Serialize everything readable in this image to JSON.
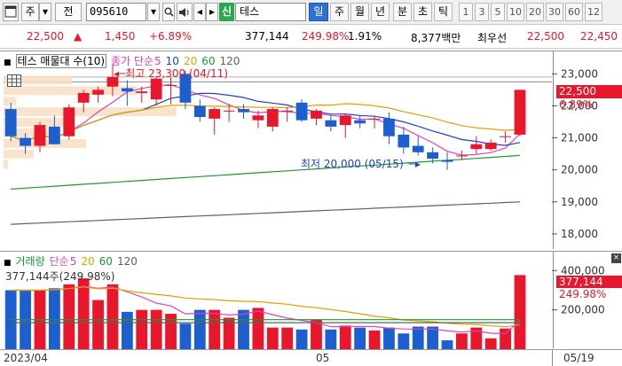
{
  "toolbar": {
    "menu_label": "주",
    "period_label": "전",
    "stock_code": "095610",
    "credit_badge": "신",
    "stock_name": "테스",
    "timeframes": [
      "일",
      "주",
      "월",
      "년",
      "분",
      "초",
      "틱"
    ],
    "active_timeframe": "일",
    "intervals": [
      "1",
      "3",
      "5",
      "10",
      "20",
      "30",
      "60",
      "12"
    ]
  },
  "quote": {
    "price": "22,500",
    "change": "1,450",
    "change_pct": "+6.89%",
    "volume": "377,144",
    "volume_ratio": "249.98%",
    "turnover_rate": "1.91%",
    "amount": "8,377백만",
    "best_ask_label": "최우선",
    "best_bid": "22,500",
    "best_ask": "22,450"
  },
  "price_panel": {
    "legend": {
      "title": "테스 매물대 수(10)",
      "ma_label": "종가 단순",
      "ma_periods": [
        "5",
        "10",
        "20",
        "60",
        "120"
      ]
    },
    "high_annotation": "최고 23,300 (04/11)",
    "low_annotation": "최저 20,000 (05/15)",
    "axis_labels": [
      "23,000",
      "22,000",
      "21,000",
      "20,000",
      "19,000",
      "18,000"
    ],
    "current_price_label": "22,500",
    "current_pct_label": "6.89%"
  },
  "volume_panel": {
    "legend": {
      "title": "거래량",
      "ma_label": "단순",
      "ma_periods": [
        "5",
        "20",
        "60",
        "120"
      ]
    },
    "value_label": "377,144주(249.98%)",
    "axis_labels": [
      "400,000",
      "200,000"
    ],
    "current_volume_label": "377,144",
    "current_pct_label": "249.98%"
  },
  "date_axis": {
    "labels": [
      "2023/04",
      "05"
    ],
    "current_date": "05/19"
  },
  "colors": {
    "up": "#e8172b",
    "down": "#1e5fd0",
    "ma5": "#e040c0",
    "ma10": "#2040d0",
    "ma20": "#e0a000",
    "ma60": "#1a9a30",
    "ma120": "#606060",
    "active_tab": "#2e6fd8"
  },
  "chart_data": [
    {
      "type": "candlestick",
      "title": "테스 매물대 수(10)",
      "series": [
        {
          "date_index": 0,
          "open": 21900,
          "high": 22100,
          "low": 20900,
          "close": 21050
        },
        {
          "date_index": 1,
          "open": 21000,
          "high": 21150,
          "low": 20500,
          "close": 20750
        },
        {
          "date_index": 2,
          "open": 20750,
          "high": 21500,
          "low": 20550,
          "close": 21400
        },
        {
          "date_index": 3,
          "open": 21350,
          "high": 21700,
          "low": 20800,
          "close": 20800
        },
        {
          "date_index": 4,
          "open": 21050,
          "high": 22050,
          "low": 20950,
          "close": 21950
        },
        {
          "date_index": 5,
          "open": 22100,
          "high": 22500,
          "low": 21800,
          "close": 22400
        },
        {
          "date_index": 6,
          "open": 22350,
          "high": 22600,
          "low": 22100,
          "close": 22500
        },
        {
          "date_index": 7,
          "open": 22600,
          "high": 23300,
          "low": 22300,
          "close": 22900
        },
        {
          "date_index": 8,
          "open": 22550,
          "high": 22800,
          "low": 22000,
          "close": 22450
        },
        {
          "date_index": 9,
          "open": 22400,
          "high": 22600,
          "low": 22100,
          "close": 22450
        },
        {
          "date_index": 10,
          "open": 22200,
          "high": 22900,
          "low": 22000,
          "close": 22850
        },
        {
          "date_index": 11,
          "open": 22650,
          "high": 22900,
          "low": 22050,
          "close": 22650
        },
        {
          "date_index": 12,
          "open": 23000,
          "high": 23100,
          "low": 21900,
          "close": 22100
        },
        {
          "date_index": 13,
          "open": 22000,
          "high": 22200,
          "low": 21500,
          "close": 21650
        },
        {
          "date_index": 14,
          "open": 21600,
          "high": 21950,
          "low": 21100,
          "close": 21900
        },
        {
          "date_index": 15,
          "open": 21850,
          "high": 22050,
          "low": 21500,
          "close": 21850
        },
        {
          "date_index": 16,
          "open": 21900,
          "high": 22050,
          "low": 21600,
          "close": 21800
        },
        {
          "date_index": 17,
          "open": 21550,
          "high": 21850,
          "low": 21300,
          "close": 21700
        },
        {
          "date_index": 18,
          "open": 21350,
          "high": 21950,
          "low": 21200,
          "close": 21900
        },
        {
          "date_index": 19,
          "open": 21850,
          "high": 21950,
          "low": 21500,
          "close": 21850
        },
        {
          "date_index": 20,
          "open": 22100,
          "high": 22200,
          "low": 21500,
          "close": 21550
        },
        {
          "date_index": 21,
          "open": 21600,
          "high": 21900,
          "low": 21400,
          "close": 21850
        },
        {
          "date_index": 22,
          "open": 21550,
          "high": 21700,
          "low": 21200,
          "close": 21350
        },
        {
          "date_index": 23,
          "open": 21400,
          "high": 21750,
          "low": 21000,
          "close": 21700
        },
        {
          "date_index": 24,
          "open": 21550,
          "high": 21700,
          "low": 21300,
          "close": 21450
        },
        {
          "date_index": 25,
          "open": 21600,
          "high": 21700,
          "low": 21300,
          "close": 21600
        },
        {
          "date_index": 26,
          "open": 21600,
          "high": 21800,
          "low": 20800,
          "close": 21050
        },
        {
          "date_index": 27,
          "open": 21100,
          "high": 21350,
          "low": 20500,
          "close": 20700
        },
        {
          "date_index": 28,
          "open": 20750,
          "high": 21050,
          "low": 20450,
          "close": 20550
        },
        {
          "date_index": 29,
          "open": 20550,
          "high": 20700,
          "low": 20200,
          "close": 20350
        },
        {
          "date_index": 30,
          "open": 20300,
          "high": 20550,
          "low": 20000,
          "close": 20250
        },
        {
          "date_index": 31,
          "open": 20450,
          "high": 20600,
          "low": 20300,
          "close": 20450
        },
        {
          "date_index": 32,
          "open": 20650,
          "high": 21050,
          "low": 20500,
          "close": 20800
        },
        {
          "date_index": 33,
          "open": 20650,
          "high": 20950,
          "low": 20600,
          "close": 20850
        },
        {
          "date_index": 34,
          "open": 21050,
          "high": 21200,
          "low": 20850,
          "close": 21050
        },
        {
          "date_index": 35,
          "open": 21100,
          "high": 22500,
          "low": 21050,
          "close": 22500
        }
      ],
      "ylim": [
        17500,
        23700
      ]
    },
    {
      "type": "bar",
      "title": "거래량",
      "values": [
        300000,
        300000,
        300000,
        310000,
        330000,
        360000,
        250000,
        330000,
        190000,
        200000,
        200000,
        180000,
        130000,
        200000,
        200000,
        160000,
        200000,
        210000,
        110000,
        110000,
        100000,
        150000,
        100000,
        120000,
        110000,
        95000,
        110000,
        80000,
        115000,
        115000,
        45000,
        80000,
        110000,
        55000,
        105000,
        377144
      ],
      "ylim": [
        0,
        460000
      ]
    }
  ]
}
